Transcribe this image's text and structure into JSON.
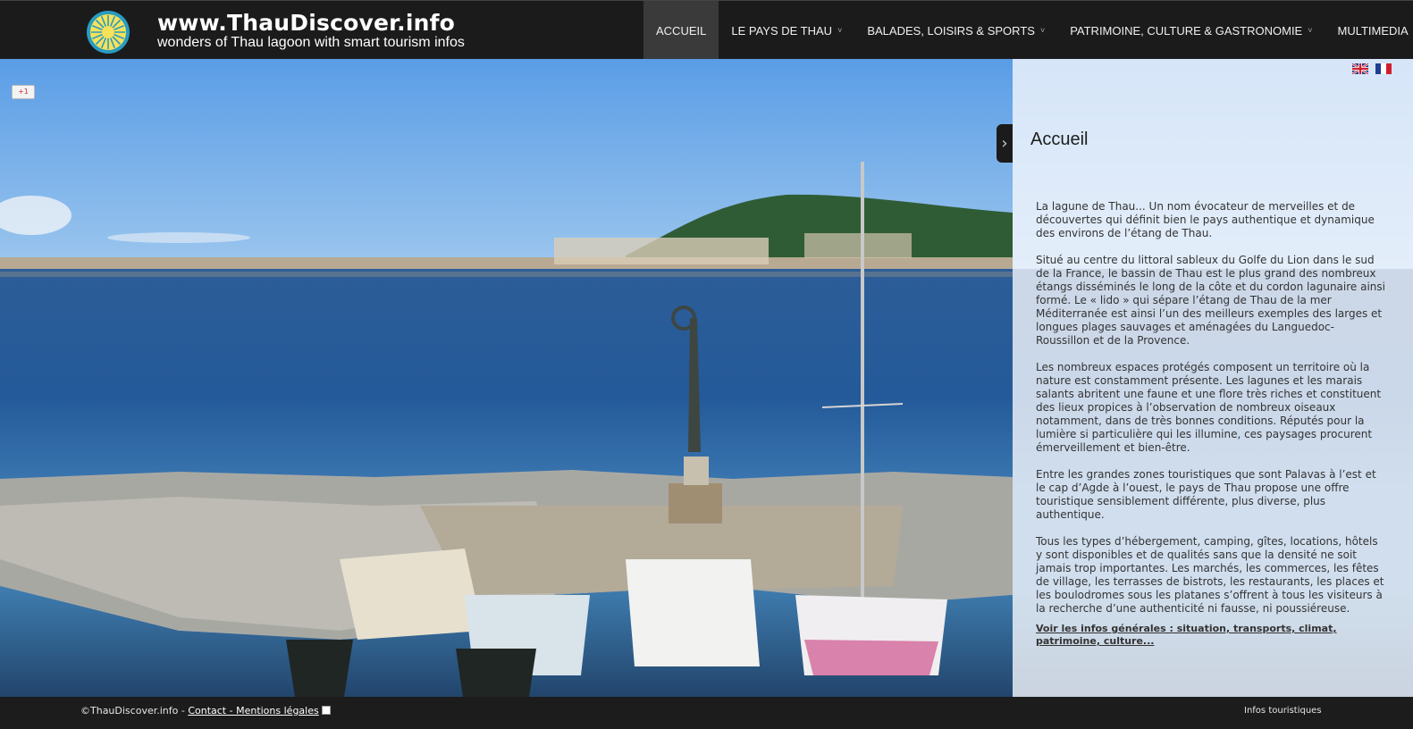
{
  "header": {
    "title": "www.ThauDiscover.info",
    "tagline": "wonders of Thau lagoon with smart tourism infos",
    "logo_icon": "sun-logo-icon"
  },
  "nav": {
    "items": [
      {
        "label": "ACCUEIL",
        "active": true,
        "has_dropdown": false
      },
      {
        "label": "LE PAYS DE THAU",
        "active": false,
        "has_dropdown": true
      },
      {
        "label": "BALADES, LOISIRS & SPORTS",
        "active": false,
        "has_dropdown": true
      },
      {
        "label": "PATRIMOINE, CULTURE & GASTRONOMIE",
        "active": false,
        "has_dropdown": true
      },
      {
        "label": "MULTIMEDIA",
        "active": false,
        "has_dropdown": true
      }
    ],
    "dropdown_icon": "˅"
  },
  "gplus": {
    "label": "+1"
  },
  "panel": {
    "title": "Accueil",
    "toggle_icon": "›",
    "paragraphs": [
      " La lagune de Thau... Un nom évocateur de merveilles et de découvertes qui définit bien le pays authentique et dynamique des environs de l’étang de Thau.",
      "Situé au centre du littoral sableux du Golfe du Lion dans le sud de la France, le bassin de Thau est le plus grand des nombreux étangs disséminés le long de la côte et du cordon lagunaire ainsi formé. Le « lido » qui sépare l’étang de Thau de la mer Méditerranée est ainsi l’un des meilleurs exemples des larges et longues plages sauvages et aménagées du Languedoc-Roussillon et de la Provence.",
      "Les nombreux espaces protégés composent un territoire où la nature est constamment présente. Les lagunes et les marais salants abritent une faune et une flore très riches et constituent des lieux propices à l’observation de nombreux oiseaux notamment, dans de très bonnes conditions. Réputés pour la lumière si particulière qui les illumine,  ces paysages procurent émerveillement et bien-être.",
      "Entre les grandes zones touristiques que sont Palavas à l’est et le cap d’Agde à l’ouest, le pays de Thau propose une offre touristique sensiblement différente,  plus diverse, plus authentique.",
      "Tous les types d’hébergement, camping, gîtes, locations, hôtels y sont disponibles et de qualités sans que la densité ne soit jamais trop importantes. Les marchés, les commerces, les fêtes de village, les terrasses de bistrots, les restaurants, les places et les boulodromes sous les platanes s’offrent à tous les visiteurs à la recherche d’une authenticité ni fausse, ni poussiéreuse."
    ],
    "link": "Voir les infos générales : situation, transports, climat, patrimoine, culture...",
    "flags": [
      "uk-flag-icon",
      "fr-flag-icon"
    ]
  },
  "footer": {
    "copyright": "©ThauDiscover.info - ",
    "link": "Contact - Mentions légales",
    "right": "Infos touristiques"
  }
}
